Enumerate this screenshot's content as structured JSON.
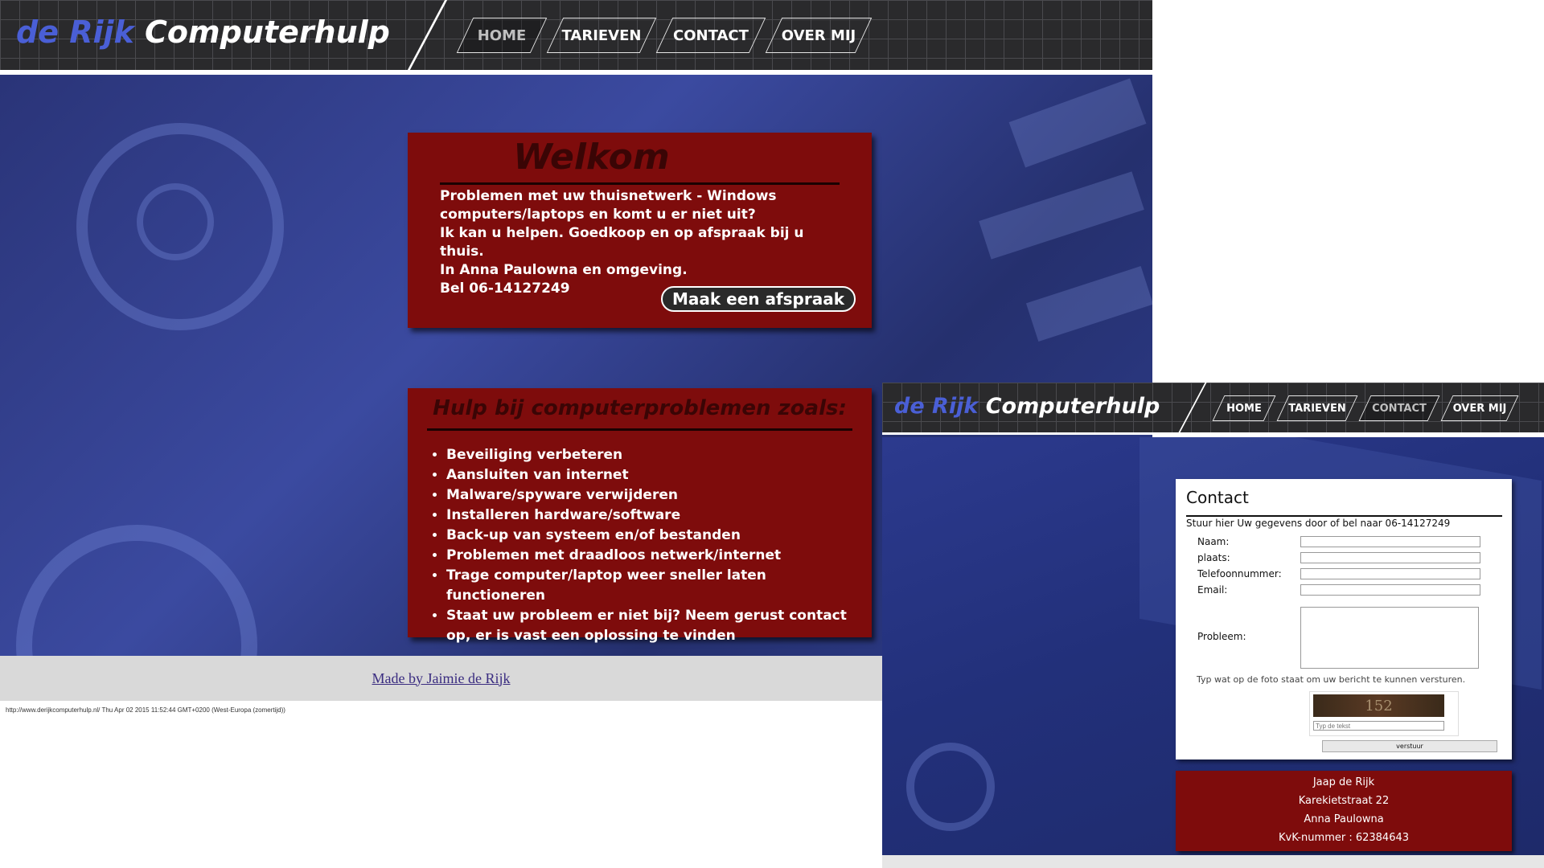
{
  "page1": {
    "logo": {
      "part1": "de Rijk",
      "part2": "Computerhulp"
    },
    "nav": [
      {
        "label": "HOME"
      },
      {
        "label": "TARIEVEN"
      },
      {
        "label": "CONTACT"
      },
      {
        "label": "OVER MIJ"
      }
    ],
    "welcome": {
      "title": "Welkom",
      "lines": [
        "Problemen met uw thuisnetwerk - Windows",
        "computers/laptops en komt u er niet uit?",
        "Ik kan u helpen. Goedkoop en op afspraak bij u thuis.",
        "In Anna Paulowna en omgeving.",
        "Bel 06-14127249"
      ],
      "button": "Maak een afspraak"
    },
    "help": {
      "title": "Hulp bij computerproblemen zoals:",
      "items": [
        "Beveiliging verbeteren",
        "Aansluiten van internet",
        "Malware/spyware verwijderen",
        "Installeren hardware/software",
        "Back-up van systeem en/of bestanden",
        "Problemen met draadloos netwerk/internet",
        "Trage computer/laptop weer sneller laten functioneren",
        "Staat uw probleem er niet bij? Neem gerust contact op, er is vast een oplossing te vinden"
      ]
    },
    "footer_link": "Made by Jaimie de Rijk",
    "print_footer": "http://www.derijkcomputerhulp.nl/ Thu Apr 02 2015 11:52:44 GMT+0200 (West-Europa (zomertijd))"
  },
  "page2": {
    "logo": {
      "part1": "de Rijk",
      "part2": "Computerhulp"
    },
    "nav": [
      {
        "label": "HOME"
      },
      {
        "label": "TARIEVEN"
      },
      {
        "label": "CONTACT"
      },
      {
        "label": "OVER MIJ"
      }
    ],
    "contact": {
      "title": "Contact",
      "subtitle": "Stuur hier Uw gegevens door of bel naar 06-14127249",
      "fields": [
        {
          "label": "Naam:",
          "value": ""
        },
        {
          "label": "plaats:",
          "value": ""
        },
        {
          "label": "Telefoonnummer:",
          "value": ""
        },
        {
          "label": "Email:",
          "value": ""
        }
      ],
      "problem_label": "Probleem:",
      "captcha_hint": "Typ wat op de foto staat om uw bericht te kunnen versturen.",
      "captcha_text": "152",
      "captcha_placeholder": "Typ de tekst",
      "submit": "verstuur"
    },
    "address": [
      "Jaap de Rijk",
      "Karekietstraat 22",
      "Anna Paulowna",
      "KvK-nummer : 62384643"
    ]
  },
  "colors": {
    "panel_red": "#7e0c0c",
    "hero_blue": "#2e3b8a",
    "logo_blue": "#4a5fd6",
    "header_dark": "#2a2a2c"
  }
}
